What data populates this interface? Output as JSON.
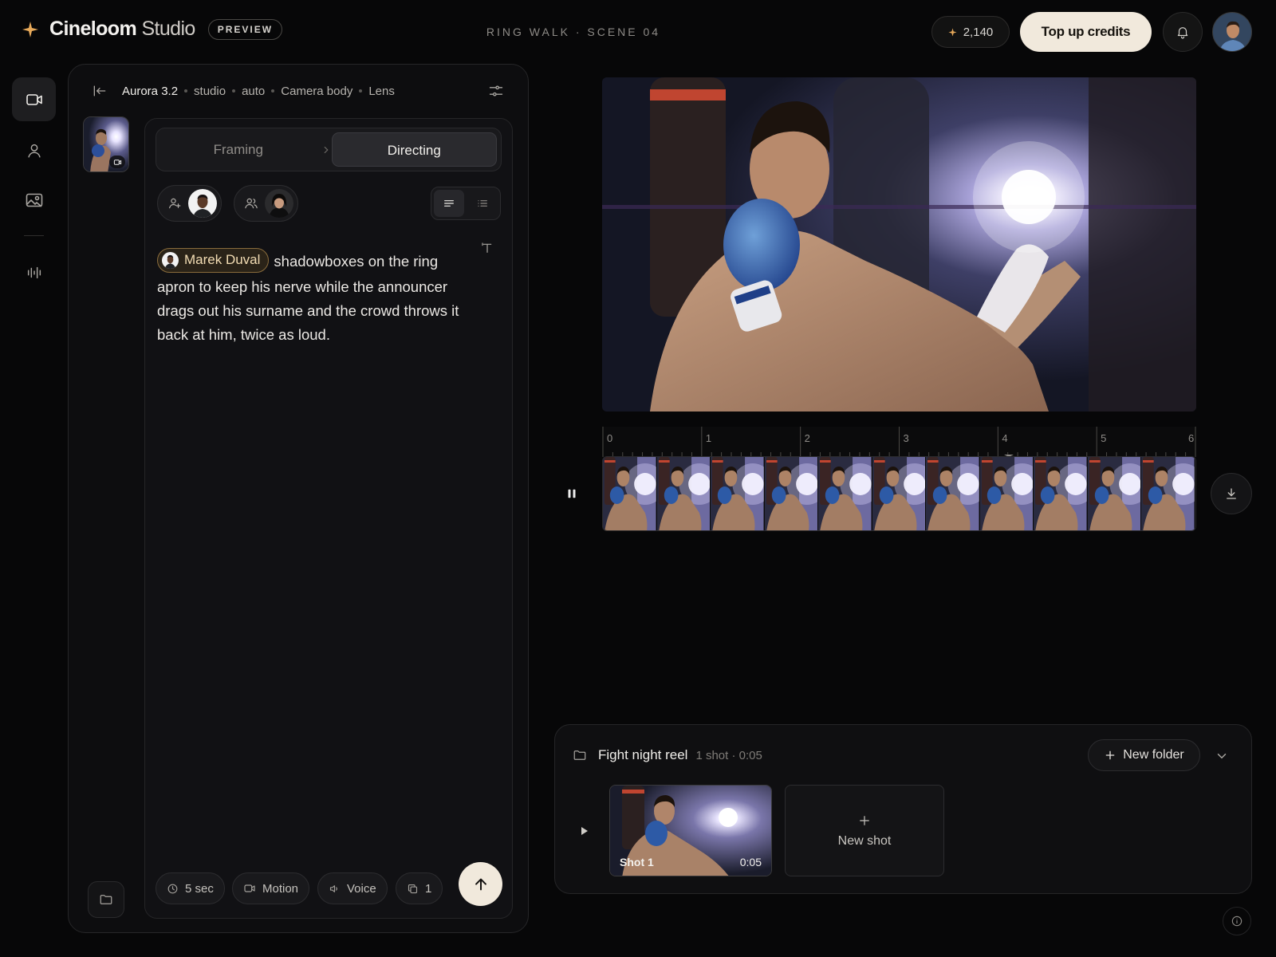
{
  "app": {
    "brand": "Cineloom",
    "brand_suffix": "Studio",
    "badge": "PREVIEW",
    "scene_title": "RING WALK · SCENE 04",
    "credits": "2,140",
    "topup_label": "Top up credits",
    "accent": "#e7a95a"
  },
  "rail": {
    "items": [
      {
        "name": "video",
        "icon": "video-camera-icon",
        "active": true
      },
      {
        "name": "characters",
        "icon": "person-icon",
        "active": false
      },
      {
        "name": "images",
        "icon": "image-icon",
        "active": false
      },
      {
        "name": "audio",
        "icon": "waveform-icon",
        "active": false
      }
    ]
  },
  "editor": {
    "model": "Aurora 3.2",
    "settings": [
      "studio",
      "auto",
      "Camera body",
      "Lens"
    ],
    "tabs": [
      {
        "label": "Framing",
        "active": false
      },
      {
        "label": "Directing",
        "active": true
      }
    ],
    "mention": "Marek Duval",
    "prompt_text": "shadowboxes on the ring apron to keep his nerve while the announcer drags out his surname and the crowd throws it back at him, twice as loud.",
    "chips": {
      "duration": "5 sec",
      "motion": "Motion",
      "voice": "Voice",
      "count": "1"
    }
  },
  "timeline": {
    "ticks": [
      "0",
      "1",
      "2",
      "3",
      "4",
      "5",
      "6"
    ],
    "frames": 11
  },
  "reel": {
    "title": "Fight night reel",
    "meta": "1 shot · 0:05",
    "new_folder_label": "New folder",
    "shots": [
      {
        "label": "Shot 1",
        "duration": "0:05"
      }
    ],
    "new_shot_label": "New shot"
  }
}
